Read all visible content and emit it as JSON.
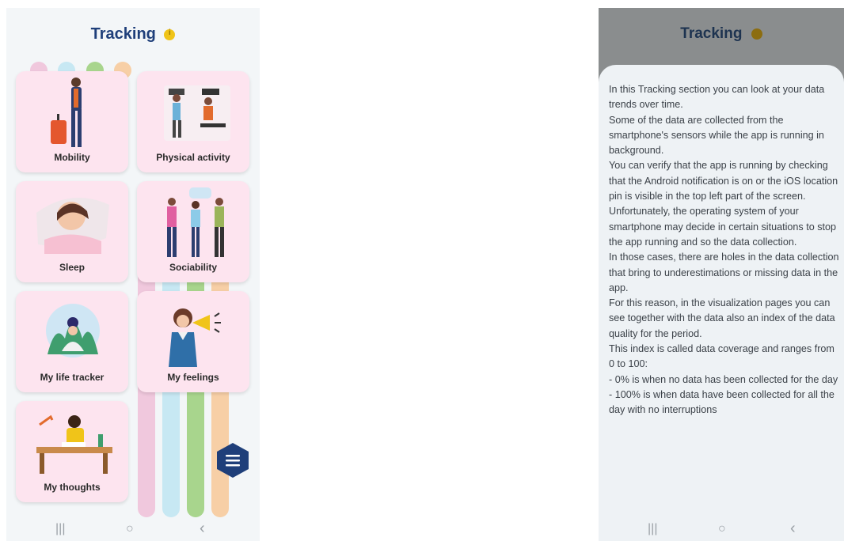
{
  "tracking": {
    "title": "Tracking",
    "tiles": [
      {
        "label": "Mobility"
      },
      {
        "label": "Physical activity"
      },
      {
        "label": "Sleep"
      },
      {
        "label": "Sociability"
      },
      {
        "label": "My life tracker"
      },
      {
        "label": "My feelings"
      },
      {
        "label": "My thoughts"
      }
    ],
    "colors": {
      "title": "#1f3f7a",
      "tile_background": "#fde4ef",
      "fab": "#1f3f7a",
      "info": "#f0c419",
      "stripes": [
        "#f0c8dd",
        "#c7e8f3",
        "#a8d58d",
        "#f7cfa6"
      ]
    }
  },
  "info_sheet": {
    "title": "Tracking",
    "lines": [
      "In this Tracking section you can look at your data trends over time.",
      "Some of the data are collected from the smartphone's sensors while the app is running in background.",
      "You can verify that the app is running by checking that the Android notification is on or the iOS location pin is visible in the top left part of the screen.",
      "Unfortunately, the operating system of your smartphone may decide in certain situations to stop the app running and so the data collection.",
      "In those cases, there are holes in the data collection that bring to underestimations or missing data in the app.",
      "For this reason, in the visualization pages you can see together with the data also an index of the data quality for the period.",
      "This index is called data coverage and ranges from 0 to 100:",
      "- 0% is when no data has been collected for the day",
      "- 100% is when data have been collected for all the day with no interruptions"
    ]
  },
  "navbar": {
    "recents_icon": "|||",
    "home_icon": "○",
    "back_icon": "‹"
  }
}
